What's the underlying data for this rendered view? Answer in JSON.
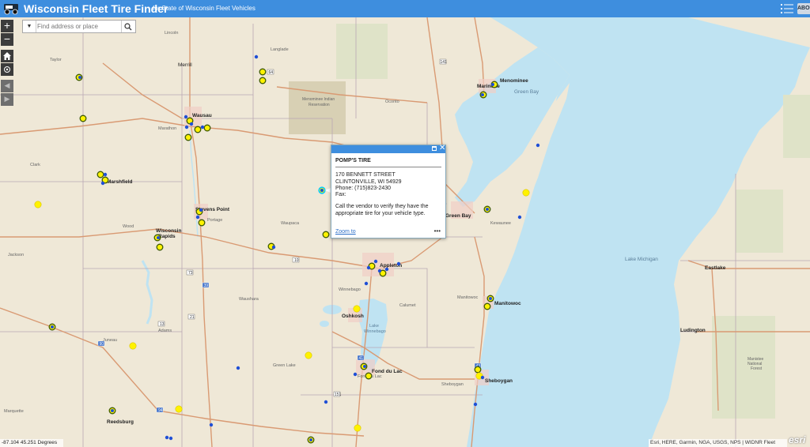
{
  "header": {
    "title": "Wisconsin Fleet Tire Finder",
    "subtitle": "for State of Wisconsin Fleet Vehicles",
    "about_label": "ABOUT"
  },
  "search": {
    "placeholder": "Find address or place"
  },
  "controls": {
    "zoom_in": "+",
    "zoom_out": "−",
    "prev_extent": "◀",
    "next_extent": "▶"
  },
  "popup": {
    "name": "POMP'S TIRE",
    "address1": "170 BENNETT STREET",
    "address2": "CLINTONVILLE, WI  54929",
    "phone": "Phone: (715)823-2430",
    "fax": "Fax:",
    "note": "Call the vendor to verify they have the appropriate tire for your vehicle type.",
    "zoom_link": "Zoom to",
    "more": "•••"
  },
  "status": {
    "coordinates": "-87.104 45.251 Degrees",
    "attribution": "Esri, HERE, Garmin, NGA, USGS, NPS | WIDNR Fleet",
    "logo": "esri"
  },
  "map_labels": {
    "cities_major": [
      "Wausau",
      "Marshfield",
      "Stevens Point",
      "Wisconsin Rapids",
      "Appleton",
      "Green Bay",
      "Oshkosh",
      "Fond du Lac",
      "Sheboygan",
      "Manitowoc",
      "Marinette",
      "Menominee",
      "Reedsburg",
      "Escanaba",
      "Ludington",
      "Eastlake"
    ],
    "places_minor": [
      "Lincoln",
      "Merrill",
      "Langlade",
      "Taylor",
      "Marathon",
      "Clark",
      "Wood",
      "Portage",
      "Adams",
      "Juneau",
      "Jackson",
      "Waushara",
      "Waupaca",
      "Winnebago",
      "Green Lake",
      "Calumet",
      "Shawano",
      "Oconto",
      "Kewaunee",
      "Menominee Indian Reservation",
      "Lake Michigan",
      "Green Bay",
      "Lake Winnebago",
      "Fond du Lac",
      "Manistee National Forest",
      "Marquette",
      "Ozaukee"
    ],
    "route_shields": [
      "29",
      "64",
      "141",
      "41",
      "10",
      "51",
      "39",
      "73",
      "13",
      "21",
      "23",
      "43",
      "151",
      "45",
      "8",
      "90",
      "94"
    ]
  },
  "markers": {
    "dealer_color": "#fff200",
    "dealer_ring": "#3d5a00",
    "vendor_color": "#1f4fd6",
    "selected_marker_color": "#00c8ff"
  }
}
